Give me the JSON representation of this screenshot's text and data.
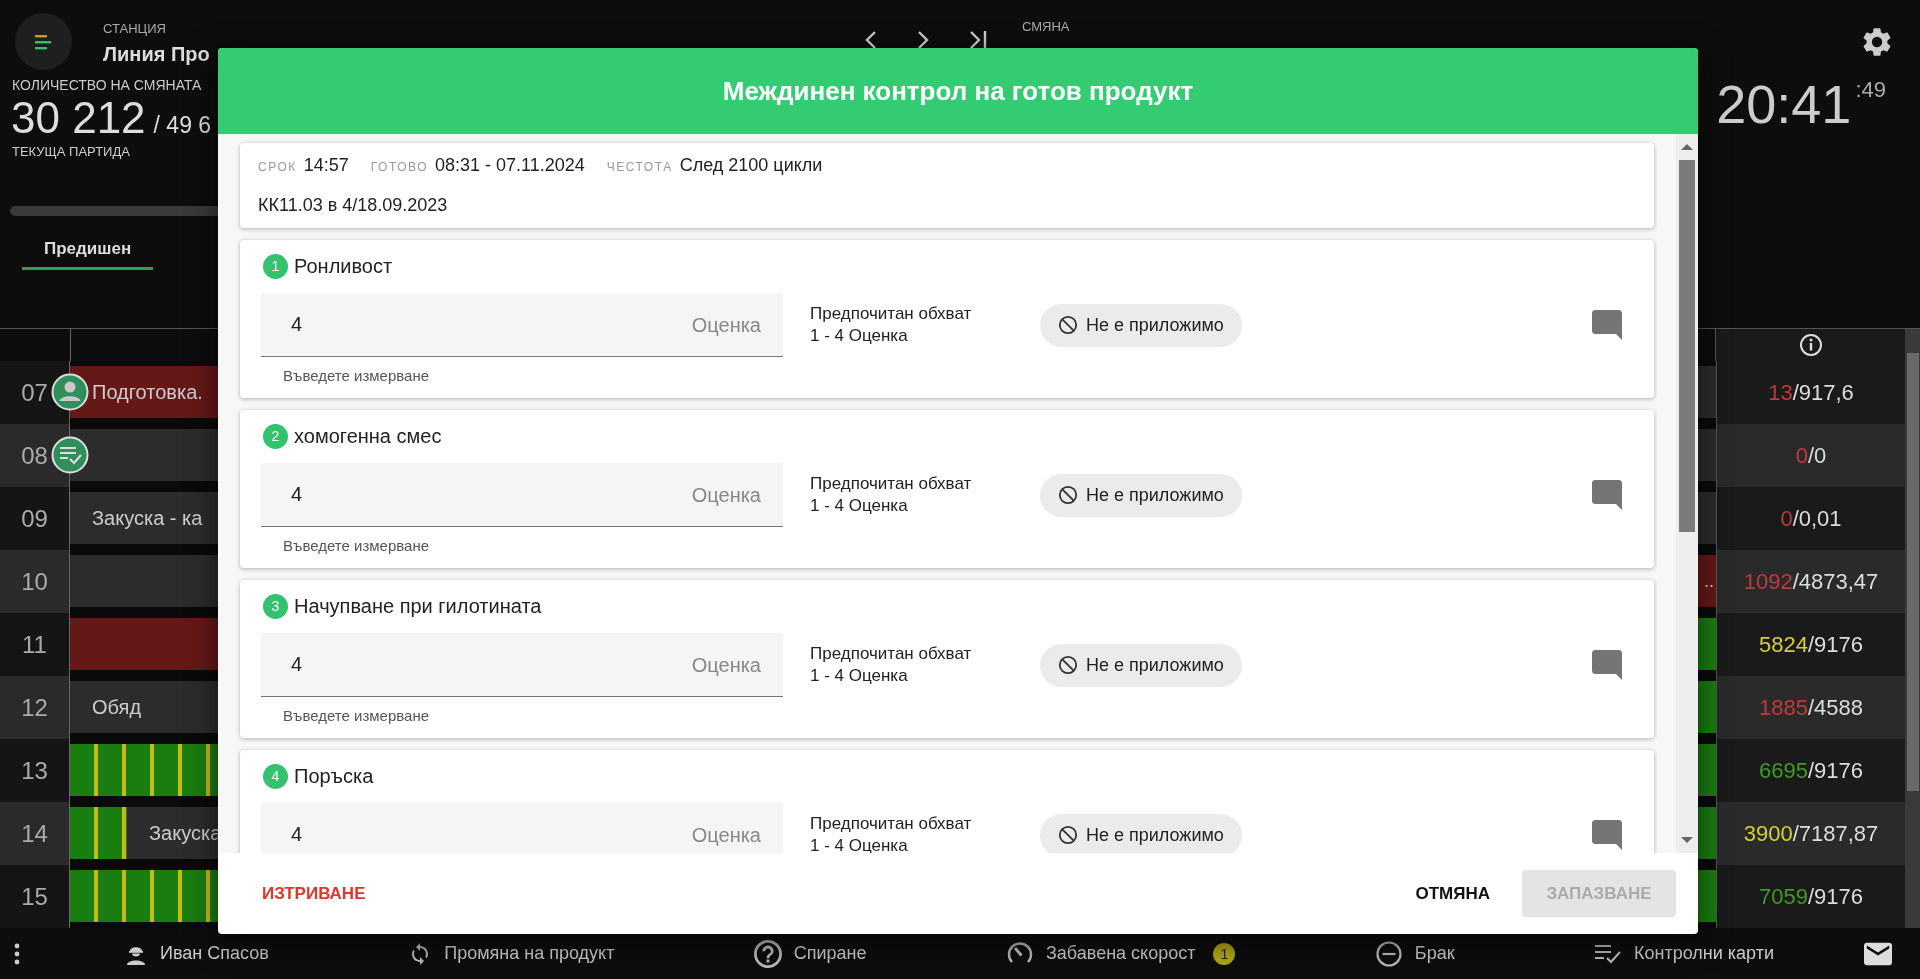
{
  "header": {
    "station_label": "СТАНЦИЯ",
    "station_name": "Линия Про",
    "shift_label": "СМЯНА",
    "quantity_label": "КОЛИЧЕСТВО НА СМЯНАТА",
    "quantity": "30 212",
    "quantity_target": "/ 49 6",
    "batch_label": "ТЕКУЩА ПАРТИДА",
    "tabs": [
      {
        "label": "Предишен",
        "selected": true
      }
    ],
    "clock": {
      "time": "20:41",
      "seconds": ":49"
    }
  },
  "timeline": {
    "rows": [
      {
        "hour": "07",
        "marker": {
          "kind": "operator"
        },
        "segments": [
          {
            "kind": "stop",
            "text": "Подготовка."
          }
        ],
        "tail": {
          "kind": "idle"
        },
        "actual": "13",
        "target": "/917,6",
        "color": "#c0393b"
      },
      {
        "hour": "08",
        "marker": {
          "kind": "checklist"
        },
        "segments": [
          {
            "kind": "idle"
          }
        ],
        "tail": {
          "kind": "idle"
        },
        "actual": "0",
        "target": "/0",
        "color": "#c0393b"
      },
      {
        "hour": "09",
        "segments": [
          {
            "kind": "idle",
            "text": "Закуска - ка"
          }
        ],
        "tail": {
          "kind": "idle"
        },
        "actual": "0",
        "target": "/0,01",
        "color": "#c0393b"
      },
      {
        "hour": "10",
        "segments": [
          {
            "kind": "idle"
          }
        ],
        "tail": {
          "kind": "stop",
          "text": ".."
        },
        "actual": "1092",
        "target": "/4873,47",
        "color": "#c0393b"
      },
      {
        "hour": "11",
        "segments": [
          {
            "kind": "stop"
          }
        ],
        "tail": {
          "kind": "run"
        },
        "actual": "5824",
        "target": "/9176",
        "color": "#d3cf3a"
      },
      {
        "hour": "12",
        "segments": [
          {
            "kind": "idle",
            "text": "Обяд"
          }
        ],
        "tail": {
          "kind": "run"
        },
        "actual": "1885",
        "target": "/4588",
        "color": "#c0393b"
      },
      {
        "hour": "13",
        "segments": [
          {
            "kind": "run"
          }
        ],
        "tail": {
          "kind": "run"
        },
        "actual": "6695",
        "target": "/9176",
        "color": "#3e9a2a"
      },
      {
        "hour": "14",
        "segments": [
          {
            "kind": "run"
          },
          {
            "kind": "idle",
            "text": "Закуска"
          }
        ],
        "tail": {
          "kind": "run"
        },
        "actual": "3900",
        "target": "/7187,87",
        "color": "#d3cf3a"
      },
      {
        "hour": "15",
        "segments": [
          {
            "kind": "run"
          }
        ],
        "tail": {
          "kind": "run"
        },
        "actual": "7059",
        "target": "/9176",
        "color": "#3e9a2a"
      }
    ]
  },
  "dialog": {
    "title": "Междинен контрол на готов продукт",
    "info": {
      "fields": [
        {
          "label": "СРОК",
          "value": "14:57"
        },
        {
          "label": "ГОТОВО",
          "value": "08:31 - 07.11.2024"
        },
        {
          "label": "ЧЕСТОТА",
          "value": "След 2100 цикли"
        }
      ],
      "reference": "КК11.03 в 4/18.09.2023"
    },
    "items": [
      {
        "number": "1",
        "name": "Ронливост",
        "value": "4",
        "unit": "Оценка",
        "helper": "Въведете измерване",
        "range_label": "Предпочитан обхват",
        "range": "1 - 4 Оценка",
        "na_label": "Не е приложимо"
      },
      {
        "number": "2",
        "name": "хомогенна смес",
        "value": "4",
        "unit": "Оценка",
        "helper": "Въведете измерване",
        "range_label": "Предпочитан обхват",
        "range": "1 - 4 Оценка",
        "na_label": "Не е приложимо"
      },
      {
        "number": "3",
        "name": "Начупване при гилотината",
        "value": "4",
        "unit": "Оценка",
        "helper": "Въведете измерване",
        "range_label": "Предпочитан обхват",
        "range": "1 - 4 Оценка",
        "na_label": "Не е приложимо"
      },
      {
        "number": "4",
        "name": "Поръска",
        "value": "4",
        "unit": "Оценка",
        "range_label": "Предпочитан обхват",
        "range": "1 - 4 Оценка",
        "na_label": "Не е приложимо"
      }
    ],
    "actions": {
      "delete": "ИЗТРИВАНЕ",
      "cancel": "ОТМЯНА",
      "save": {
        "label": "ЗАПАЗВАНЕ",
        "disabled": true
      }
    }
  },
  "bottom_bar": {
    "items": [
      {
        "kind": "worker",
        "label": "Иван Спасов"
      },
      {
        "kind": "sync",
        "label": "Промяна на продукт"
      },
      {
        "kind": "help",
        "label": "Спиране"
      },
      {
        "kind": "gauge",
        "label": "Забавена скорост",
        "badge": "1"
      },
      {
        "kind": "minus",
        "label": "Брак"
      },
      {
        "kind": "checklist",
        "label": "Контролни карти"
      }
    ]
  }
}
